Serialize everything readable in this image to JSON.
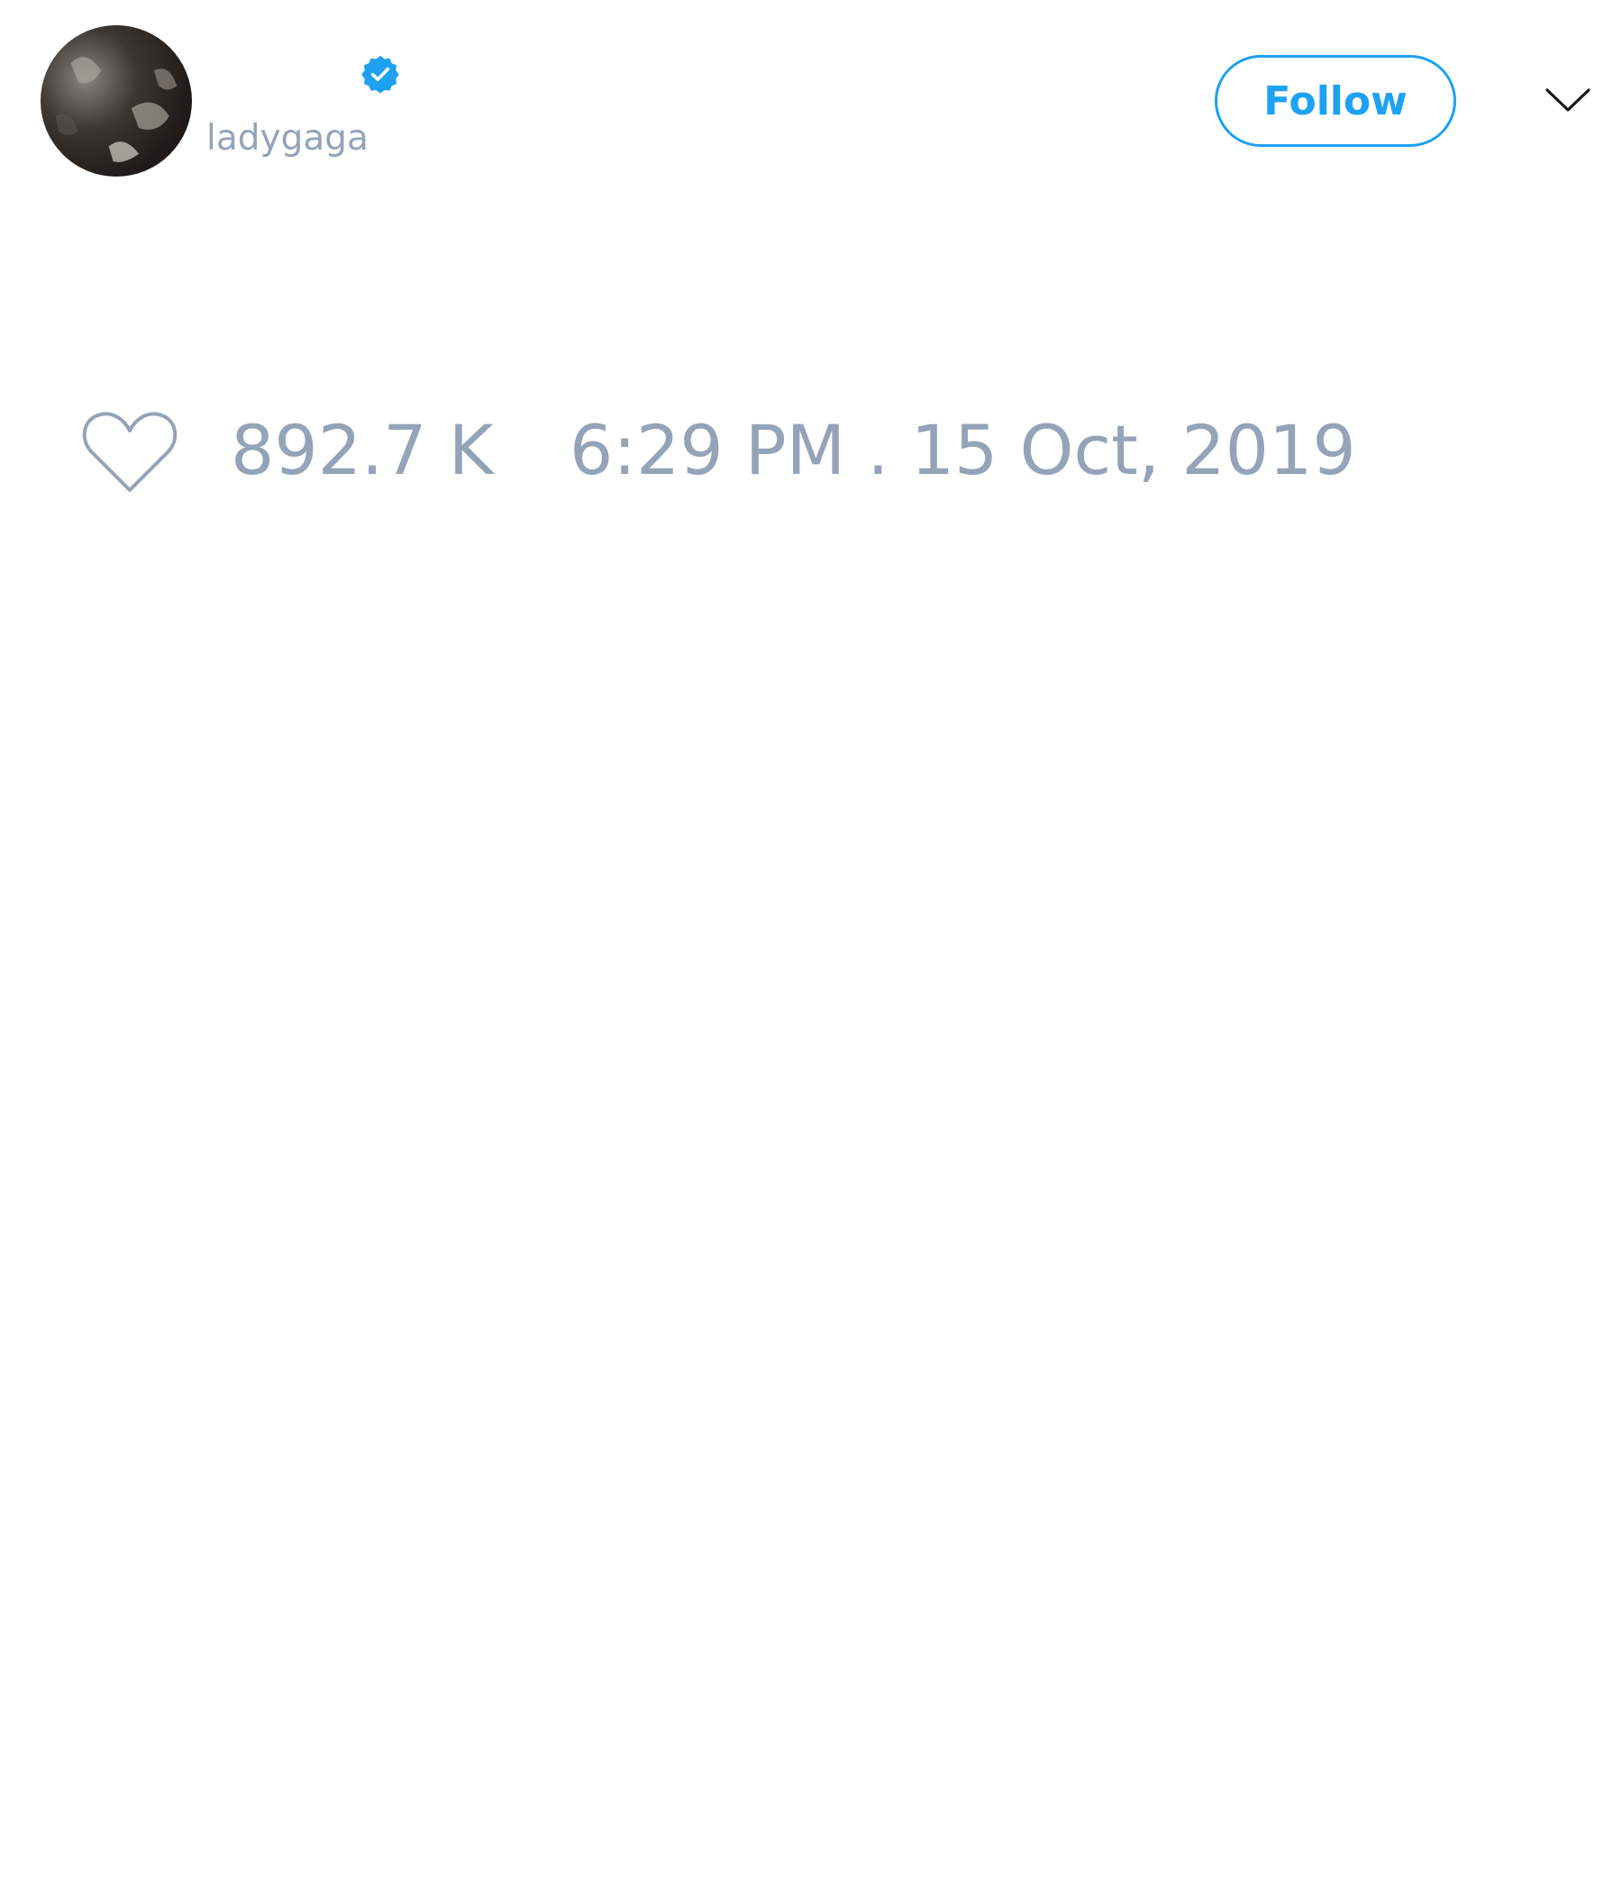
{
  "tweet": {
    "author": {
      "display_name": "",
      "handle": "ladygaga",
      "verified": true,
      "avatar_icon": "avatar-photo"
    },
    "follow_label": "Follow",
    "more_icon": "chevron-down-icon",
    "like_icon": "heart-icon",
    "like_count": "892.7 K",
    "timestamp": "6:29 PM . 15 Oct, 2019"
  },
  "colors": {
    "accent": "#1da1f2",
    "muted_text": "#94a3b8",
    "background": "#ffffff"
  }
}
